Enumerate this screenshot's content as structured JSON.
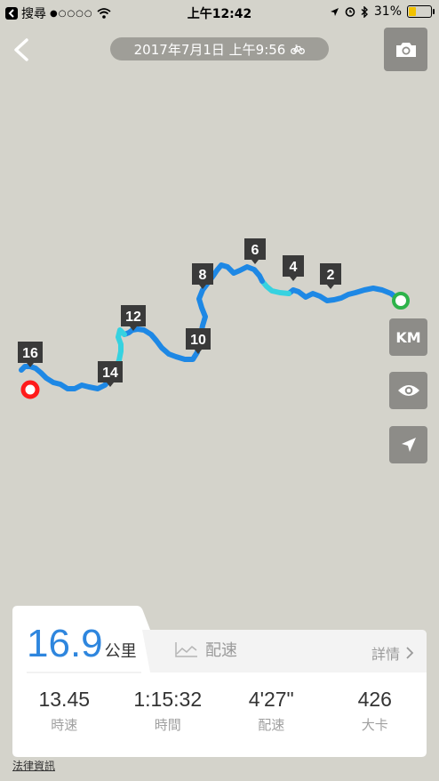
{
  "status_bar": {
    "carrier": "搜尋",
    "time": "上午12:42",
    "battery": "31%"
  },
  "header": {
    "date": "2017年7月1日 上午9:56"
  },
  "map": {
    "km_label": "KM",
    "markers": [
      "2",
      "4",
      "6",
      "8",
      "10",
      "12",
      "14",
      "16"
    ]
  },
  "summary": {
    "distance": "16.9",
    "distance_unit": "公里",
    "pace_tab": "配速",
    "details": "詳情",
    "stats": [
      {
        "value": "13.45",
        "label": "時速"
      },
      {
        "value": "1:15:32",
        "label": "時間"
      },
      {
        "value": "4'27\"",
        "label": "配速"
      },
      {
        "value": "426",
        "label": "大卡"
      }
    ]
  },
  "legal": "法律資訊",
  "colors": {
    "route": "#1e88e5",
    "route_fast": "#36d2e0",
    "start": "#2db34a",
    "end": "#ff1b1b"
  }
}
